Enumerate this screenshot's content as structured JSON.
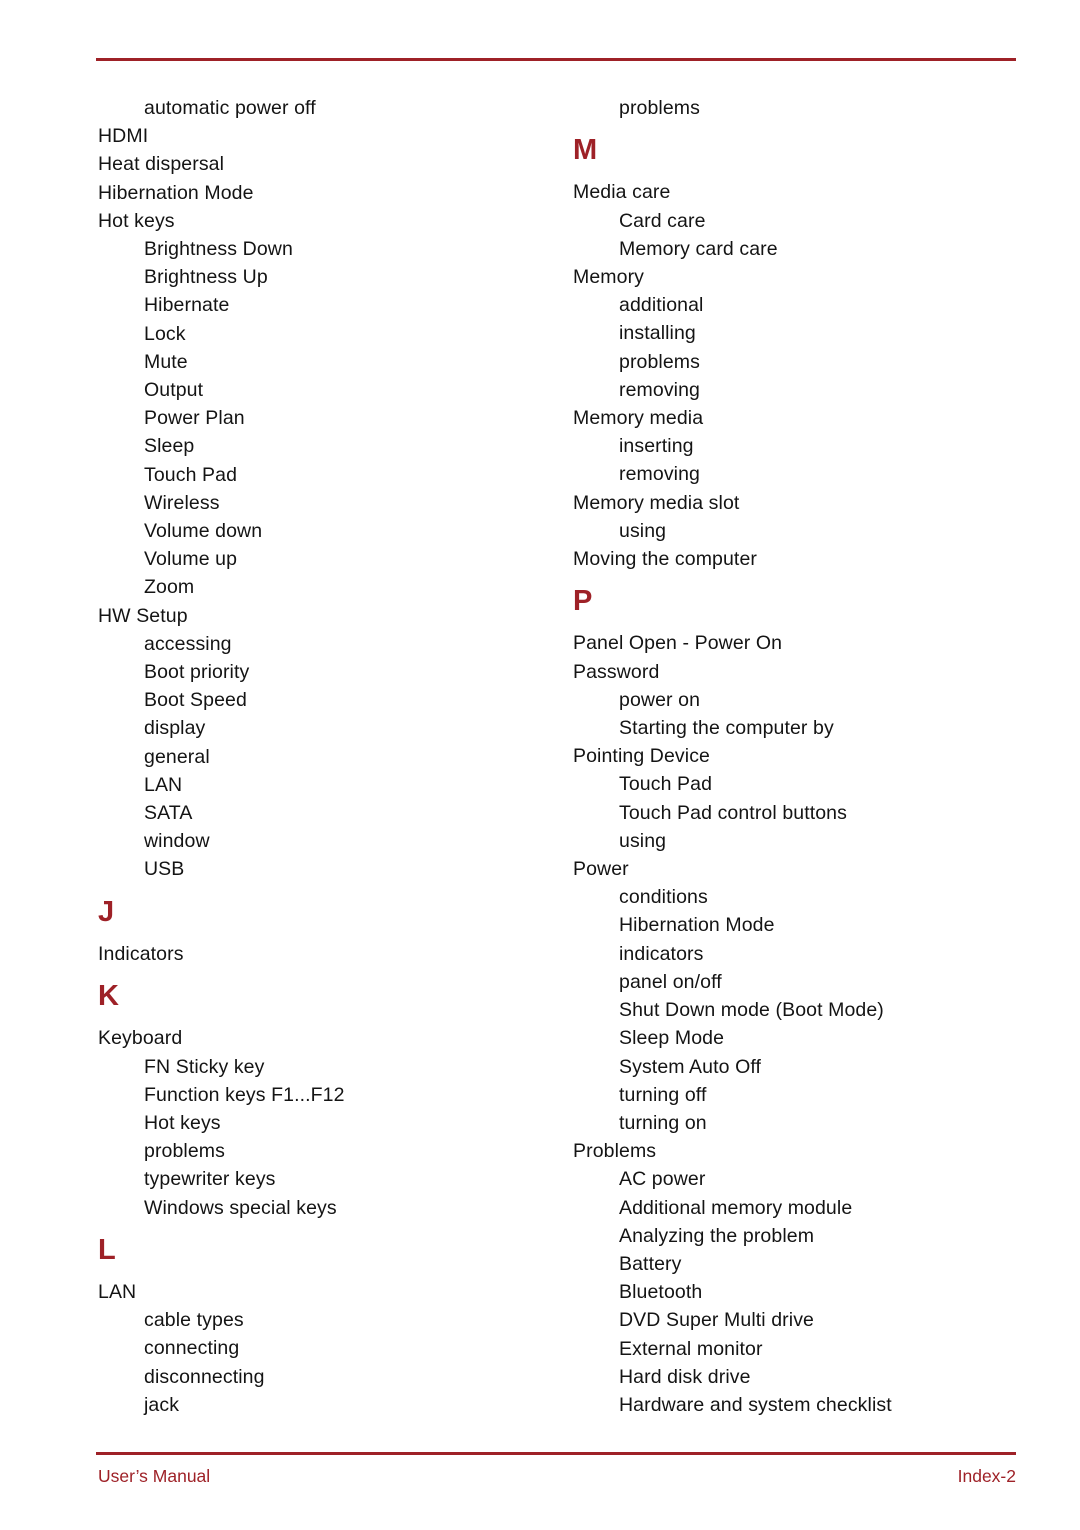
{
  "document": {
    "type": "index-page",
    "accent_color": "#9e2127",
    "text_color": "#141414",
    "background_color": "#ffffff"
  },
  "columns": {
    "left": [
      {
        "level": 2,
        "text": "automatic power off"
      },
      {
        "level": 1,
        "text": "HDMI"
      },
      {
        "level": 1,
        "text": "Heat dispersal"
      },
      {
        "level": 1,
        "text": "Hibernation Mode"
      },
      {
        "level": 1,
        "text": "Hot keys"
      },
      {
        "level": 2,
        "text": "Brightness Down"
      },
      {
        "level": 2,
        "text": "Brightness Up"
      },
      {
        "level": 2,
        "text": "Hibernate"
      },
      {
        "level": 2,
        "text": "Lock"
      },
      {
        "level": 2,
        "text": "Mute"
      },
      {
        "level": 2,
        "text": "Output"
      },
      {
        "level": 2,
        "text": "Power Plan"
      },
      {
        "level": 2,
        "text": "Sleep"
      },
      {
        "level": 2,
        "text": "Touch Pad"
      },
      {
        "level": 2,
        "text": "Wireless"
      },
      {
        "level": 2,
        "text": "Volume down"
      },
      {
        "level": 2,
        "text": "Volume up"
      },
      {
        "level": 2,
        "text": "Zoom"
      },
      {
        "level": 1,
        "text": "HW Setup"
      },
      {
        "level": 2,
        "text": "accessing"
      },
      {
        "level": 2,
        "text": "Boot priority"
      },
      {
        "level": 2,
        "text": "Boot Speed"
      },
      {
        "level": 2,
        "text": "display"
      },
      {
        "level": 2,
        "text": "general"
      },
      {
        "level": 2,
        "text": "LAN"
      },
      {
        "level": 2,
        "text": "SATA"
      },
      {
        "level": 2,
        "text": "window"
      },
      {
        "level": 2,
        "text": "USB"
      },
      {
        "level": 0,
        "text": "J"
      },
      {
        "level": 1,
        "text": "Indicators"
      },
      {
        "level": 0,
        "text": "K"
      },
      {
        "level": 1,
        "text": "Keyboard"
      },
      {
        "level": 2,
        "text": "FN Sticky key"
      },
      {
        "level": 2,
        "text": "Function keys F1...F12"
      },
      {
        "level": 2,
        "text": "Hot keys"
      },
      {
        "level": 2,
        "text": "problems"
      },
      {
        "level": 2,
        "text": "typewriter keys"
      },
      {
        "level": 2,
        "text": "Windows special keys"
      },
      {
        "level": 0,
        "text": "L"
      },
      {
        "level": 1,
        "text": "LAN"
      },
      {
        "level": 2,
        "text": "cable types"
      },
      {
        "level": 2,
        "text": "connecting"
      },
      {
        "level": 2,
        "text": "disconnecting"
      },
      {
        "level": 2,
        "text": "jack"
      }
    ],
    "right": [
      {
        "level": 2,
        "text": "problems"
      },
      {
        "level": 0,
        "text": "M"
      },
      {
        "level": 1,
        "text": "Media care"
      },
      {
        "level": 2,
        "text": "Card care"
      },
      {
        "level": 2,
        "text": "Memory card care"
      },
      {
        "level": 1,
        "text": "Memory"
      },
      {
        "level": 2,
        "text": "additional"
      },
      {
        "level": 2,
        "text": "installing"
      },
      {
        "level": 2,
        "text": "problems"
      },
      {
        "level": 2,
        "text": "removing"
      },
      {
        "level": 1,
        "text": "Memory media"
      },
      {
        "level": 2,
        "text": "inserting"
      },
      {
        "level": 2,
        "text": "removing"
      },
      {
        "level": 1,
        "text": "Memory media slot"
      },
      {
        "level": 2,
        "text": "using"
      },
      {
        "level": 1,
        "text": "Moving the computer"
      },
      {
        "level": 0,
        "text": "P"
      },
      {
        "level": 1,
        "text": "Panel Open - Power On"
      },
      {
        "level": 1,
        "text": "Password"
      },
      {
        "level": 2,
        "text": "power on"
      },
      {
        "level": 2,
        "text": "Starting the computer by"
      },
      {
        "level": 1,
        "text": "Pointing Device"
      },
      {
        "level": 2,
        "text": "Touch Pad"
      },
      {
        "level": 2,
        "text": "Touch Pad control buttons"
      },
      {
        "level": 2,
        "text": "using"
      },
      {
        "level": 1,
        "text": "Power"
      },
      {
        "level": 2,
        "text": "conditions"
      },
      {
        "level": 2,
        "text": "Hibernation Mode"
      },
      {
        "level": 2,
        "text": "indicators"
      },
      {
        "level": 2,
        "text": "panel on/off"
      },
      {
        "level": 2,
        "text": "Shut Down mode (Boot Mode)"
      },
      {
        "level": 2,
        "text": "Sleep Mode"
      },
      {
        "level": 2,
        "text": "System Auto Off"
      },
      {
        "level": 2,
        "text": "turning off"
      },
      {
        "level": 2,
        "text": "turning on"
      },
      {
        "level": 1,
        "text": "Problems"
      },
      {
        "level": 2,
        "text": "AC power"
      },
      {
        "level": 2,
        "text": "Additional memory module"
      },
      {
        "level": 2,
        "text": "Analyzing the problem"
      },
      {
        "level": 2,
        "text": "Battery"
      },
      {
        "level": 2,
        "text": "Bluetooth"
      },
      {
        "level": 2,
        "text": "DVD Super Multi drive"
      },
      {
        "level": 2,
        "text": "External monitor"
      },
      {
        "level": 2,
        "text": "Hard disk drive"
      },
      {
        "level": 2,
        "text": "Hardware and system checklist"
      }
    ]
  },
  "footer": {
    "left": "User’s Manual",
    "right": "Index-2"
  }
}
